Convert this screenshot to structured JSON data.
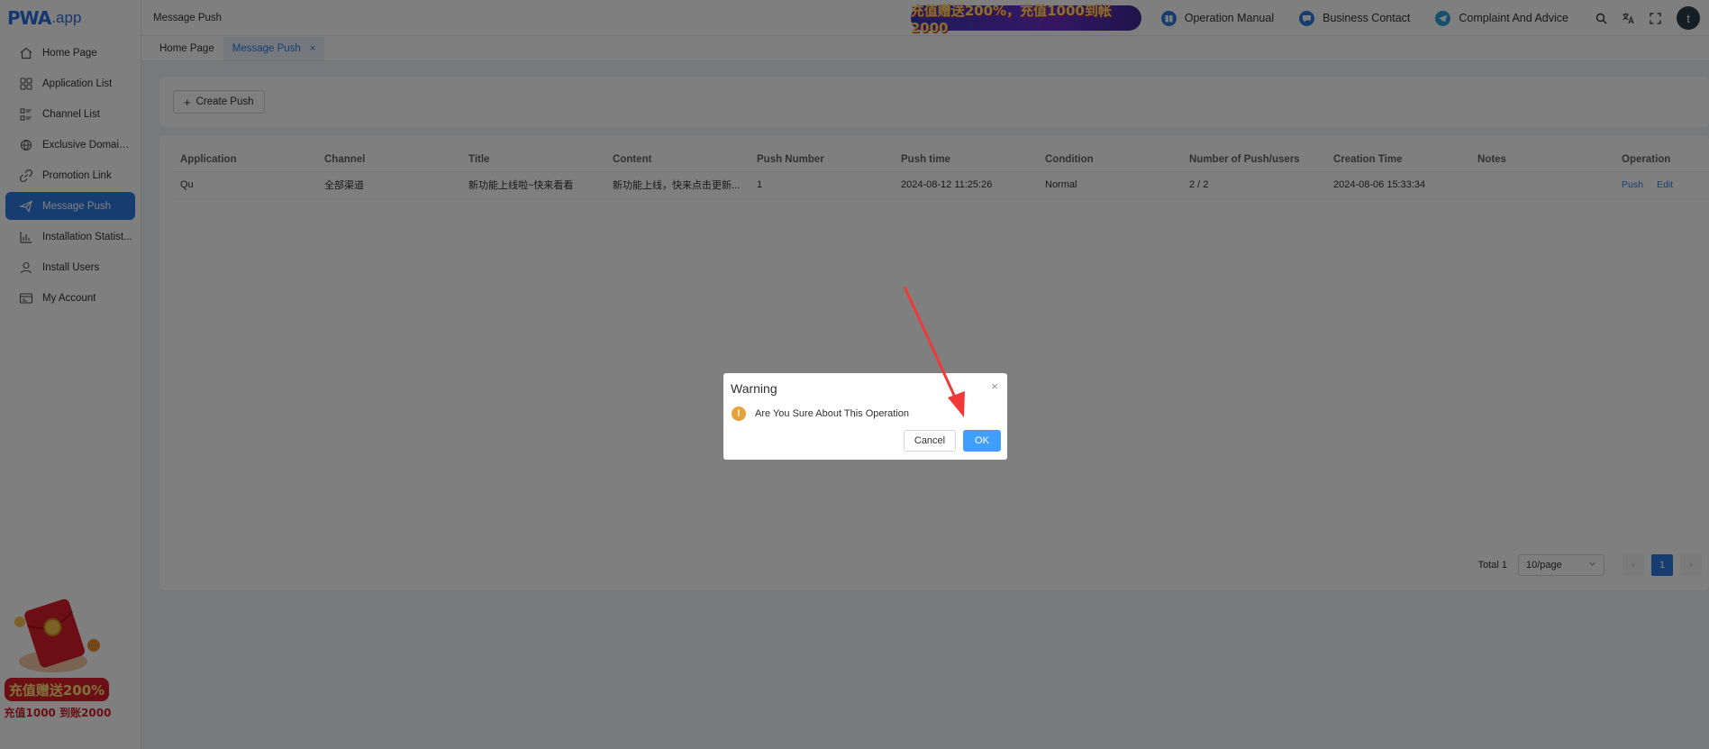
{
  "app": {
    "logo_mark": "PWA",
    "logo_domain": ".app"
  },
  "sidebar": {
    "items": [
      {
        "label": "Home Page",
        "icon": "home-icon"
      },
      {
        "label": "Application List",
        "icon": "apps-grid-icon"
      },
      {
        "label": "Channel List",
        "icon": "list-icon"
      },
      {
        "label": "Exclusive Domain...",
        "icon": "globe-icon"
      },
      {
        "label": "Promotion Link",
        "icon": "link-icon"
      },
      {
        "label": "Message Push",
        "icon": "paper-plane-icon",
        "active": true
      },
      {
        "label": "Installation Statist...",
        "icon": "bar-chart-icon"
      },
      {
        "label": "Install Users",
        "icon": "user-icon"
      },
      {
        "label": "My Account",
        "icon": "account-card-icon"
      }
    ],
    "promo_line1": "充值赠送200%",
    "promo_line2": "充值1000 到账2000"
  },
  "topbar": {
    "breadcrumb": "Message Push",
    "banner_text": "充值赠送200%，充值1000到帐2000",
    "links": [
      {
        "label": "Operation Manual",
        "icon": "book-icon"
      },
      {
        "label": "Business Contact",
        "icon": "chat-icon"
      },
      {
        "label": "Complaint And Advice",
        "icon": "telegram-icon"
      }
    ],
    "avatar_letter": "t"
  },
  "tabs": [
    {
      "label": "Home Page"
    },
    {
      "label": "Message Push",
      "active": true,
      "close": "×"
    }
  ],
  "toolbar": {
    "create_label": "Create Push",
    "create_icon": "+"
  },
  "table": {
    "columns": [
      "Application",
      "Channel",
      "Title",
      "Content",
      "Push Number",
      "Push time",
      "Condition",
      "Number of Push/users",
      "Creation Time",
      "Notes",
      "Operation"
    ],
    "rows": [
      {
        "application": "Qu",
        "channel": "全部渠道",
        "title": "新功能上线啦~快来看看",
        "content": "新功能上线，快来点击更新...",
        "push_number": "1",
        "push_time": "2024-08-12 11:25:26",
        "condition": "Normal",
        "push_users": "2 / 2",
        "creation_time": "2024-08-06 15:33:34",
        "notes": "",
        "op_push": "Push",
        "op_edit": "Edit"
      }
    ]
  },
  "pagination": {
    "total_text": "Total 1",
    "page_size": "10/page",
    "current_page": "1",
    "prev": "‹",
    "next": "›"
  },
  "dialog": {
    "title": "Warning",
    "close": "×",
    "warn_symbol": "!",
    "message": "Are You Sure About This Operation",
    "cancel_label": "Cancel",
    "ok_label": "OK"
  },
  "colors": {
    "accent": "#2e7be0",
    "ok_button": "#409eff",
    "warning": "#e6a23c",
    "status_normal": "#2f9e44",
    "annotation_arrow": "#f03a3a"
  }
}
